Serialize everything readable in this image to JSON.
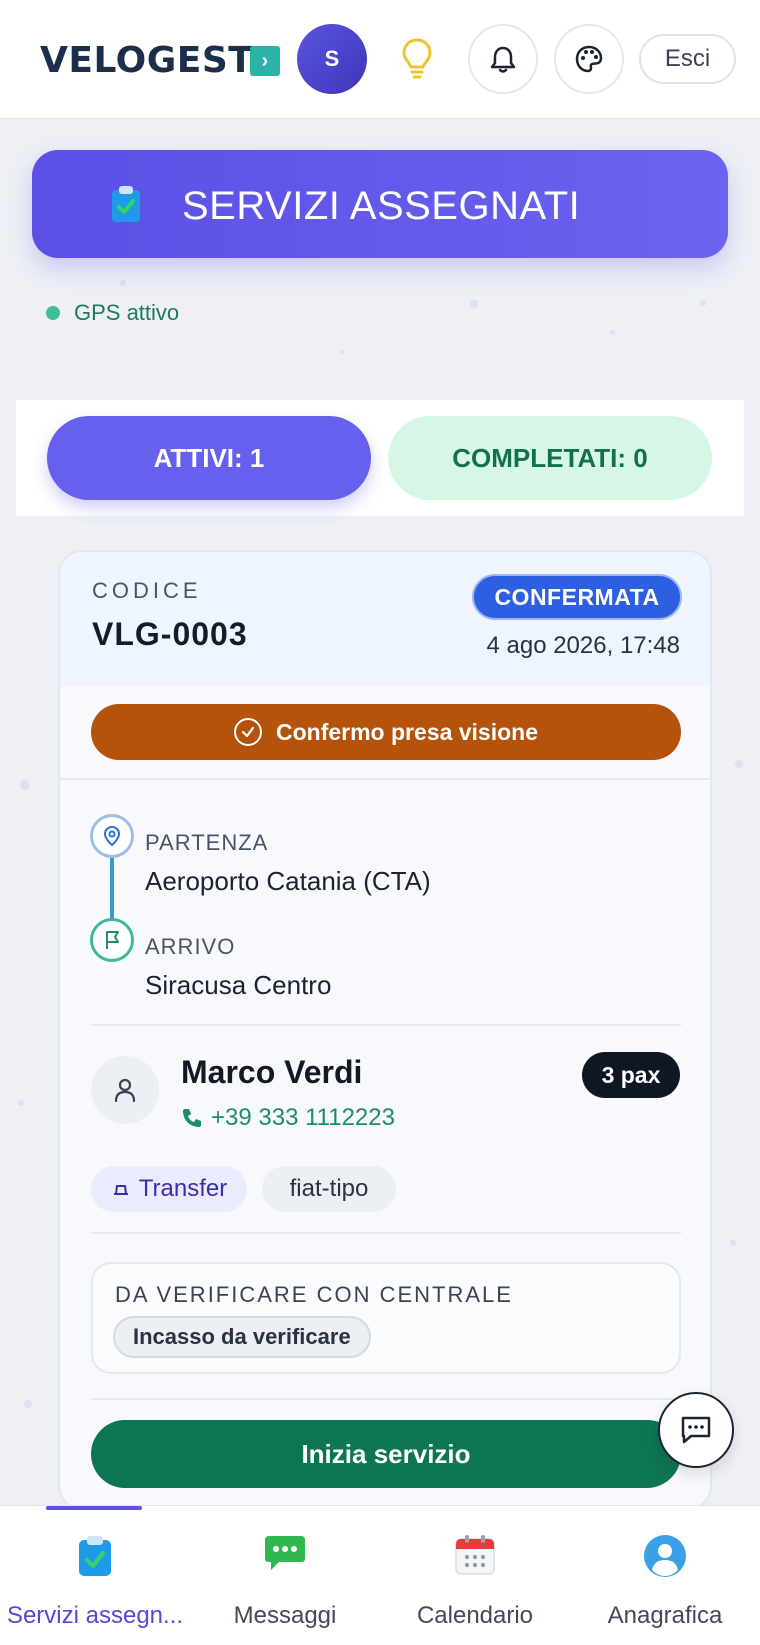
{
  "header": {
    "logo_text": "VELOGEST",
    "logo_mark": "›",
    "avatar_initial": "S",
    "logout_label": "Esci",
    "icons": [
      "lightbulb-icon",
      "bell-icon",
      "palette-icon"
    ]
  },
  "banner": {
    "title": "SERVIZI ASSEGNATI",
    "icon": "clipboard-check-icon"
  },
  "gps": {
    "label": "GPS attivo",
    "color": "#3fbf94"
  },
  "tabs": {
    "active_label": "ATTIVI: 1",
    "completed_label": "COMPLETATI: 0"
  },
  "service": {
    "code_label": "CODICE",
    "code": "VLG-0003",
    "status": "CONFERMATA",
    "datetime": "4 ago 2026, 17:48",
    "confirm_label": "Confermo presa visione",
    "departure_label": "PARTENZA",
    "departure": "Aeroporto Catania (CTA)",
    "arrival_label": "ARRIVO",
    "arrival": "Siracusa Centro",
    "customer_name": "Marco Verdi",
    "customer_phone": "+39 333 1112223",
    "pax": "3 pax",
    "service_type": "Transfer",
    "vehicle": "fiat-tipo",
    "verify_title": "DA VERIFICARE CON CENTRALE",
    "verify_item": "Incasso da verificare",
    "start_label": "Inizia servizio"
  },
  "bottom_nav": [
    {
      "label": "Servizi assegn...",
      "icon": "clipboard-check-icon",
      "active": true
    },
    {
      "label": "Messaggi",
      "icon": "chat-bubble-icon",
      "active": false
    },
    {
      "label": "Calendario",
      "icon": "calendar-icon",
      "active": false
    },
    {
      "label": "Anagrafica",
      "icon": "user-profile-icon",
      "active": false
    }
  ],
  "colors": {
    "brand": "#5b4fe6",
    "confirm_orange": "#b5530b",
    "start_green": "#0d7553",
    "status_blue": "#2d5fe0"
  }
}
